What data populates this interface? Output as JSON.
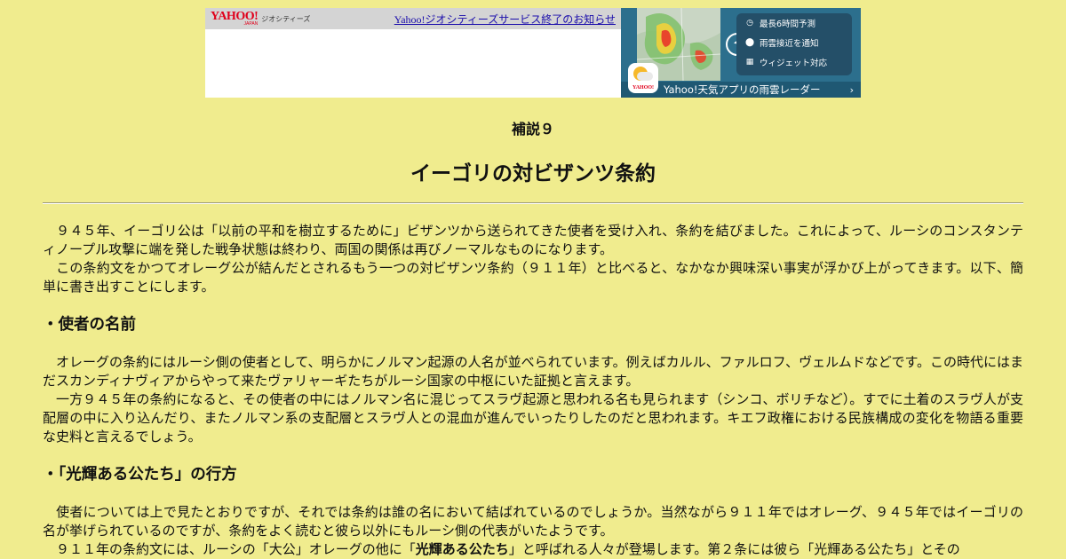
{
  "banner": {
    "logo_main": "YAHOO!",
    "logo_sub_small": "JAPAN",
    "logo_service": "ジオシティーズ",
    "notice_link": "Yahoo!ジオシティーズサービス終了のお知らせ",
    "ad": {
      "menu": [
        {
          "icon": "clock-icon",
          "label": "最長6時間予測"
        },
        {
          "icon": "location-pin-icon",
          "label": "雨雲接近を通知"
        },
        {
          "icon": "widget-icon",
          "label": "ウィジェット対応"
        }
      ],
      "app_icon_label": "YAHOO!",
      "cta": "Yahoo!天気アプリの雨雲レーダー",
      "cta_chevron": "›"
    }
  },
  "article": {
    "kicker": "補説９",
    "title": "イーゴリの対ビザンツ条約",
    "intro": [
      "　９４５年、イーゴリ公は「以前の平和を樹立するために」ビザンツから送られてきた使者を受け入れ、条約を結びました。これによって、ルーシのコンスタンティノープル攻撃に端を発した戦争状態は終わり、両国の関係は再びノーマルなものになります。",
      "　この条約文をかつてオレーグ公が結んだとされるもう一つの対ビザンツ条約（９１１年）と比べると、なかなか興味深い事実が浮かび上がってきます。以下、簡単に書き出すことにします。"
    ],
    "section1": {
      "heading": "・使者の名前",
      "paragraphs": [
        "　オレーグの条約にはルーシ側の使者として、明らかにノルマン起源の人名が並べられています。例えばカルル、ファルロフ、ヴェルムドなどです。この時代にはまだスカンディナヴィアからやって来たヴァリャーギたちがルーシ国家の中枢にいた証拠と言えます。",
        "　一方９４５年の条約になると、その使者の中にはノルマン名に混じってスラヴ起源と思われる名も見られます（シンコ、ボリチなど）。すでに土着のスラヴ人が支配層の中に入り込んだり、またノルマン系の支配層とスラヴ人との混血が進んでいったりしたのだと思われます。キエフ政権における民族構成の変化を物語る重要な史料と言えるでしょう。"
      ]
    },
    "section2": {
      "heading": "・「光輝ある公たち」の行方",
      "paragraphs": [
        "　使者については上で見たとおりですが、それでは条約は誰の名において結ばれているのでしょうか。当然ながら９１１年ではオレーグ、９４５年ではイーゴリの名が挙げられているのですが、条約をよく読むと彼ら以外にもルーシ側の代表がいたようです。"
      ],
      "last_paragraph": {
        "before": "　９１１年の条約文には、ルーシの「大公」オレーグの他に「",
        "bold": "光輝ある公たち",
        "after": "」と呼ばれる人々が登場します。第２条には彼ら「光輝ある公たち」とその"
      }
    }
  }
}
